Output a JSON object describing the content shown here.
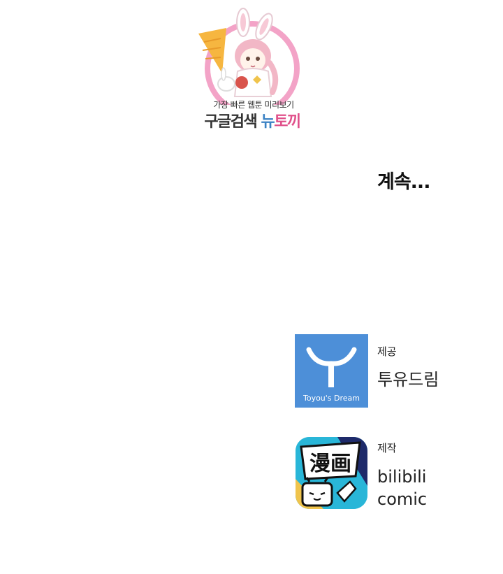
{
  "watermark": {
    "line1": "가장 빠른 웹툰 미리보기",
    "line2_part1": "구글검색 ",
    "line2_part2": "뉴",
    "line2_part3": "토끼"
  },
  "continue_text": "계속...",
  "credits": {
    "provided_label": "제공",
    "provider_name": "투유드림",
    "provider_logo_text": "Toyou's Dream",
    "produced_label": "제작",
    "producer_line1": "bilibili",
    "producer_line2": "comic",
    "producer_logo_text": "漫画"
  },
  "colors": {
    "toyou_blue": "#4d8fd8",
    "bili_cyan": "#29b6d8",
    "watermark_pink": "#e0508a",
    "watermark_blue": "#3b82c4"
  }
}
